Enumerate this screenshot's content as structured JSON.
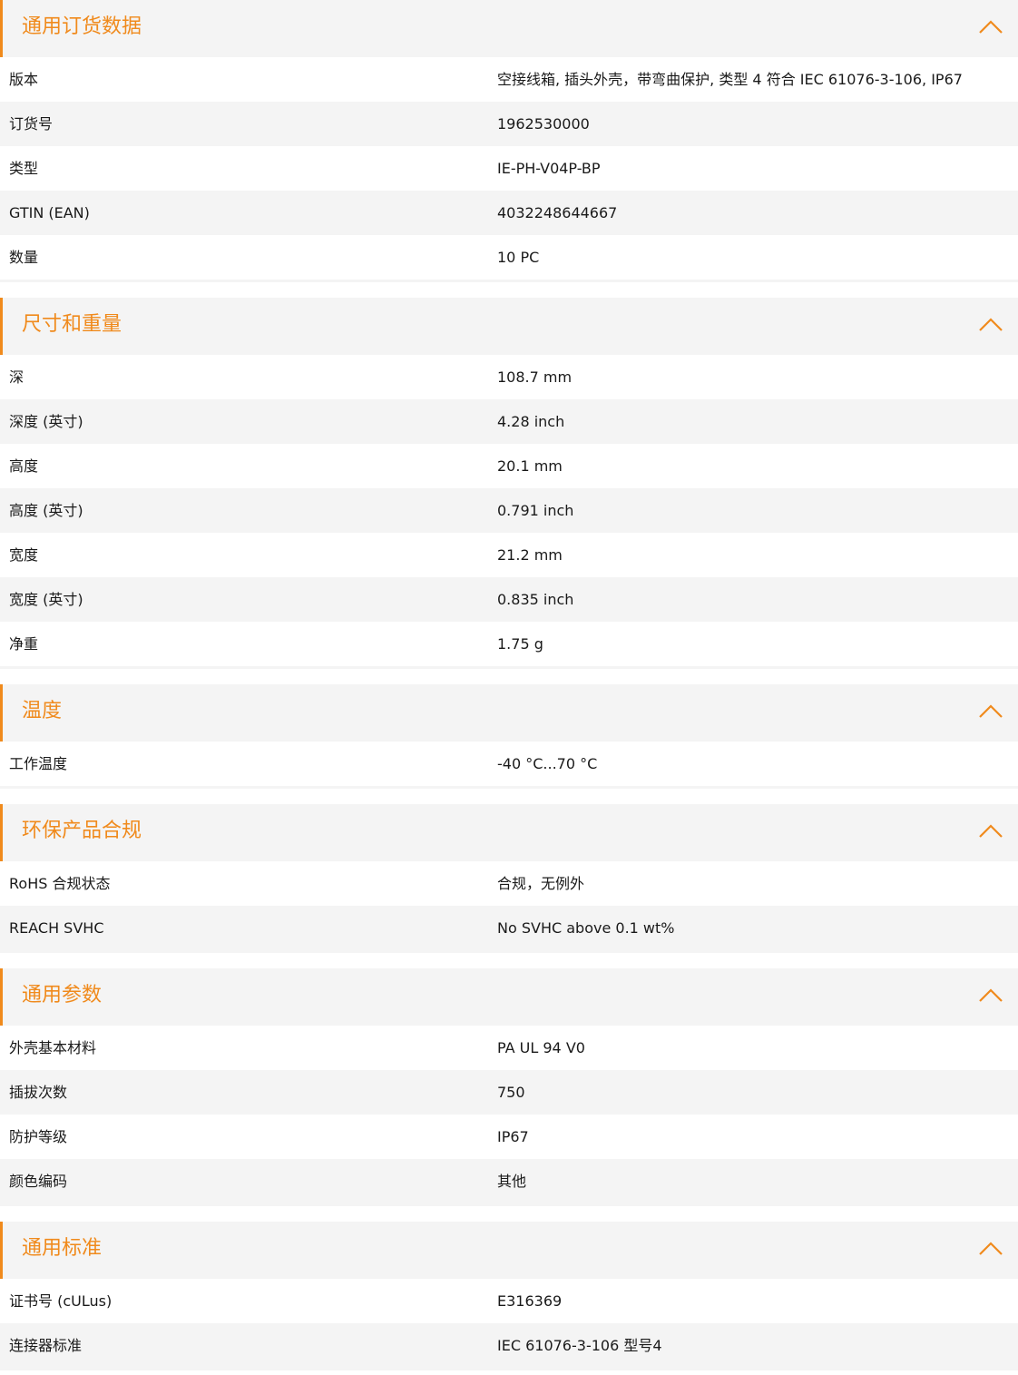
{
  "accent_color": "#f08a1c",
  "icons": {
    "collapse": "chevron-up-icon"
  },
  "sections": [
    {
      "id": "ordering",
      "title": "通用订货数据",
      "rows": [
        {
          "label": "版本",
          "value": "空接线箱, 插头外壳，带弯曲保护, 类型 4 符合 IEC 61076-3-106, IP67"
        },
        {
          "label": "订货号",
          "value": "1962530000"
        },
        {
          "label": "类型",
          "value": "IE-PH-V04P-BP"
        },
        {
          "label": "GTIN (EAN)",
          "value": "4032248644667"
        },
        {
          "label": "数量",
          "value": "10  PC"
        }
      ]
    },
    {
      "id": "dimensions",
      "title": "尺寸和重量",
      "rows": [
        {
          "label": "深",
          "value": "108.7  mm"
        },
        {
          "label": "深度 (英寸)",
          "value": "4.28  inch"
        },
        {
          "label": "高度",
          "value": "20.1  mm"
        },
        {
          "label": "高度 (英寸)",
          "value": "0.791  inch"
        },
        {
          "label": "宽度",
          "value": "21.2  mm"
        },
        {
          "label": "宽度 (英寸)",
          "value": "0.835  inch"
        },
        {
          "label": "净重",
          "value": "1.75  g"
        }
      ]
    },
    {
      "id": "temperature",
      "title": "温度",
      "rows": [
        {
          "label": "工作温度",
          "value": "-40 °C...70 °C"
        }
      ]
    },
    {
      "id": "environmental",
      "title": "环保产品合规",
      "rows": [
        {
          "label": "RoHS 合规状态",
          "value": "合规，无例外"
        },
        {
          "label": "REACH SVHC",
          "value": "No SVHC above 0.1 wt%"
        }
      ]
    },
    {
      "id": "general-params",
      "title": "通用参数",
      "rows": [
        {
          "label": "外壳基本材料",
          "value": "PA UL 94 V0"
        },
        {
          "label": "插拔次数",
          "value": "750"
        },
        {
          "label": "防护等级",
          "value": "IP67"
        },
        {
          "label": "颜色编码",
          "value": "其他"
        }
      ]
    },
    {
      "id": "general-standards",
      "title": "通用标准",
      "rows": [
        {
          "label": "证书号 (cULus)",
          "value": "E316369"
        },
        {
          "label": "连接器标准",
          "value": "IEC 61076-3-106 型号4"
        }
      ]
    }
  ]
}
